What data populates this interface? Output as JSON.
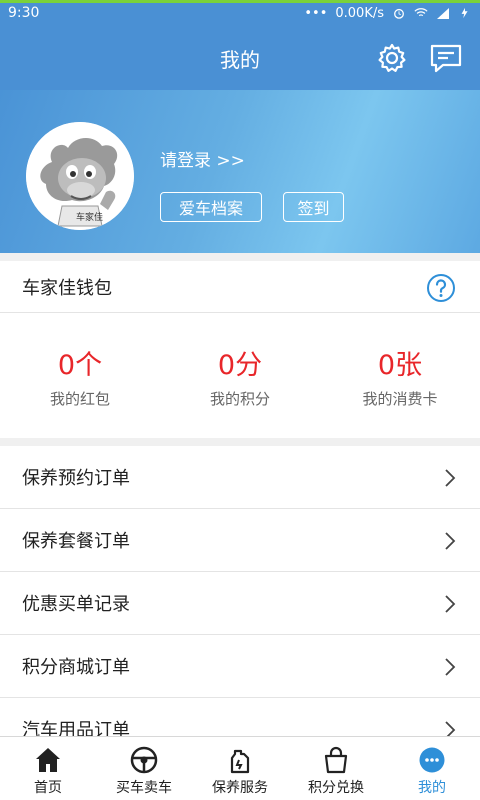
{
  "status_bar": {
    "time": "9:30",
    "net_speed": "0.00K/s"
  },
  "header": {
    "title": "我的"
  },
  "profile": {
    "login_text": "请登录 >>",
    "archive_button": "爱车档案",
    "checkin_button": "签到",
    "avatar_caption": "车家佳"
  },
  "wallet": {
    "title": "车家佳钱包",
    "stats": [
      {
        "value": "0个",
        "label": "我的红包"
      },
      {
        "value": "0分",
        "label": "我的积分"
      },
      {
        "value": "0张",
        "label": "我的消费卡"
      }
    ]
  },
  "menu": {
    "items": [
      {
        "label": "保养预约订单"
      },
      {
        "label": "保养套餐订单"
      },
      {
        "label": "优惠买单记录"
      },
      {
        "label": "积分商城订单"
      },
      {
        "label": "汽车用品订单"
      }
    ]
  },
  "tabs": [
    {
      "label": "首页",
      "icon": "home-icon"
    },
    {
      "label": "买车卖车",
      "icon": "steering-wheel-icon"
    },
    {
      "label": "保养服务",
      "icon": "oil-can-icon"
    },
    {
      "label": "积分兑换",
      "icon": "shopping-bag-icon"
    },
    {
      "label": "我的",
      "icon": "smiley-icon",
      "active": true
    }
  ],
  "colors": {
    "primary": "#4a90d4",
    "accent_red": "#e8262a",
    "active_tab": "#2e8fd8"
  }
}
